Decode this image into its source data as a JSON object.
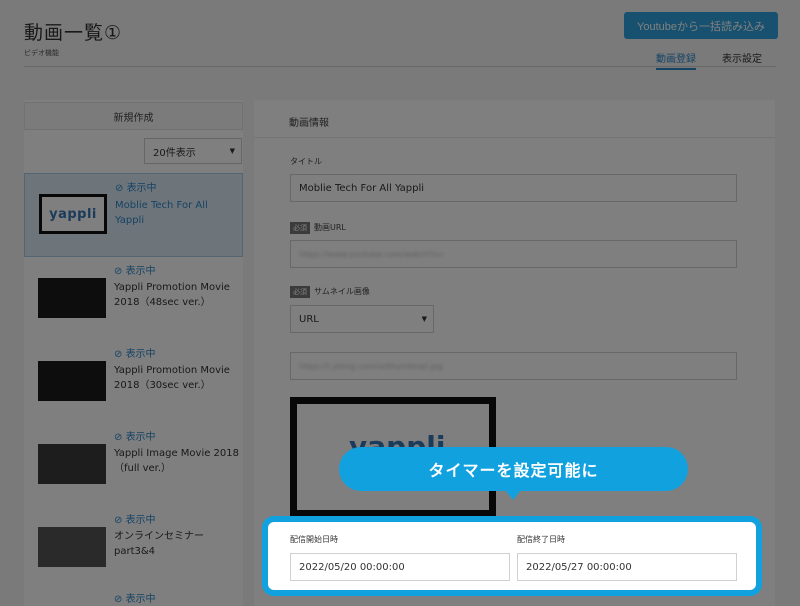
{
  "header": {
    "title": "動画一覧①",
    "subtitle": "ビデオ機能",
    "youtube_button": "Youtubeから一括読み込み",
    "tabs": [
      {
        "label": "動画登録",
        "active": true
      },
      {
        "label": "表示設定",
        "active": false
      }
    ]
  },
  "sidebar": {
    "new_button": "新規作成",
    "count_select": "20件表示",
    "videos": [
      {
        "status": "表示中",
        "title": "Moblie Tech For All Yappli",
        "thumb_text": "yappli",
        "selected": true
      },
      {
        "status": "表示中",
        "title": "Yappli Promotion Movie 2018（48sec ver.）",
        "thumb_text": "",
        "selected": false
      },
      {
        "status": "表示中",
        "title": "Yappli Promotion Movie 2018（30sec ver.）",
        "thumb_text": "",
        "selected": false
      },
      {
        "status": "表示中",
        "title": "Yappli Image Movie 2018（full ver.）",
        "thumb_text": "",
        "selected": false
      },
      {
        "status": "表示中",
        "title": "オンラインセミナーpart3&4",
        "thumb_text": "",
        "selected": false
      },
      {
        "status": "表示中",
        "title": "",
        "thumb_text": "",
        "selected": false
      }
    ]
  },
  "form": {
    "section_title": "動画情報",
    "title_label": "タイトル",
    "title_value": "Moblie Tech For All Yappli",
    "required_badge": "必須",
    "url_label": "動画URL",
    "url_value": "https://www.youtube.com/watch?v=",
    "thumbnail_label": "サムネイル画像",
    "thumbnail_type": "URL",
    "thumbnail_url": "https://i.ytimg.com/vi/thumbnail.jpg",
    "preview_text": "yappli",
    "start_label": "配信開始日時",
    "start_value": "2022/05/20 00:00:00",
    "end_label": "配信終了日時",
    "end_value": "2022/05/27 00:00:00"
  },
  "callout": {
    "text": "タイマーを設定可能に",
    "color": "#12a1df"
  }
}
